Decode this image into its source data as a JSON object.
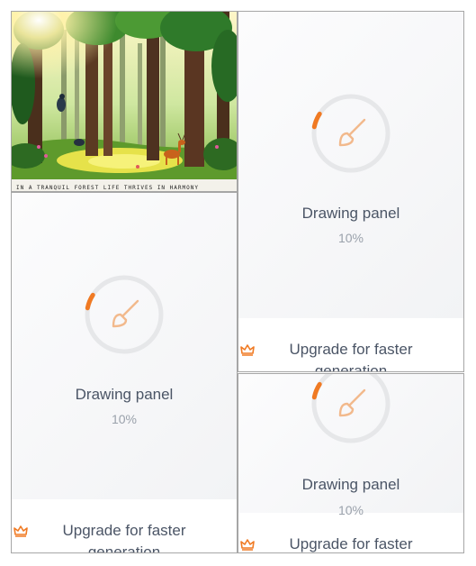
{
  "image_card": {
    "caption": "IN A TRANQUIL FOREST LIFE THRIVES IN HARMONY"
  },
  "panels": [
    {
      "status": "Drawing panel",
      "progress": "10%",
      "upgrade": "Upgrade for faster generation"
    },
    {
      "status": "Drawing panel",
      "progress": "10%",
      "upgrade": "Upgrade for faster generation"
    },
    {
      "status": "Drawing panel",
      "progress": "10%",
      "upgrade": "Upgrade for faster"
    }
  ],
  "colors": {
    "accent": "#f07a23",
    "ring_track": "#e6e7e9",
    "brush": "#f2b98c",
    "text": "#4b5566",
    "muted": "#9aa1ab"
  },
  "icons": {
    "panel": "paintbrush-icon",
    "upgrade": "crown-icon"
  }
}
